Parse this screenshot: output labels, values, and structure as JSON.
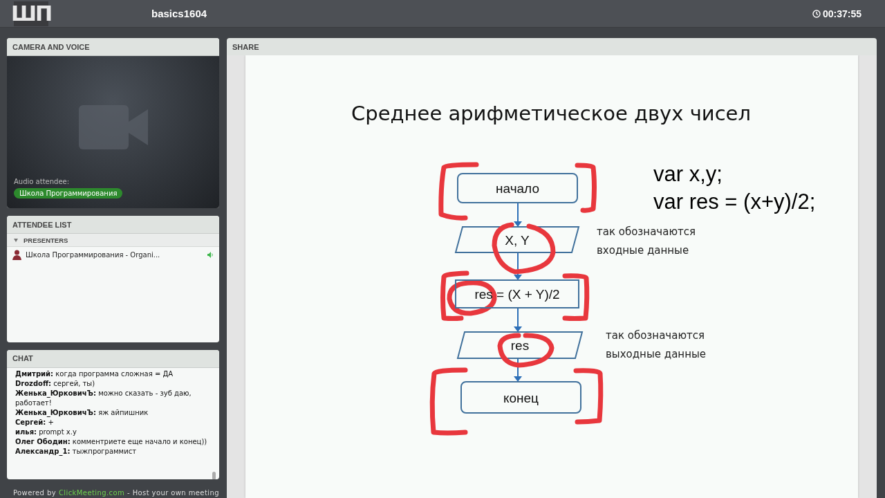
{
  "header": {
    "logo": "ШП",
    "title": "basics1604",
    "timer": "00:37:55"
  },
  "camera": {
    "title": "CAMERA AND VOICE",
    "audio_label": "Audio attendee:",
    "audio_name": "Школа Программирования"
  },
  "attendees": {
    "title": "ATTENDEE LIST",
    "groups": [
      {
        "name": "PRESENTERS",
        "expanded": true,
        "members": [
          {
            "name": "Школа Программирования - Organi...",
            "speaking": true
          }
        ]
      }
    ]
  },
  "chat": {
    "title": "CHAT",
    "messages": [
      {
        "author": "Дмитрий:",
        "text": "когда программа сложная = ДА"
      },
      {
        "author": "Drozdoff:",
        "text": "сергей, ты)"
      },
      {
        "author": "Женька_ЮрковичЪ:",
        "text": "можно сказать - зуб даю, работает!"
      },
      {
        "author": "Женька_ЮрковичЪ:",
        "text": "яж айпишник"
      },
      {
        "author": "Сергей:",
        "text": "+"
      },
      {
        "author": "илья:",
        "text": "prompt x.y"
      },
      {
        "author": "Олег Ободин:",
        "text": "комментриете еще начало и конец))"
      },
      {
        "author": "Александр_1:",
        "text": "тыжпрограммист"
      }
    ]
  },
  "footer": {
    "prefix": "Powered by",
    "link": "ClickMeeting.com",
    "suffix": "- Host your own meeting"
  },
  "share": {
    "title": "SHARE",
    "slide": {
      "title": "Среднее арифметическое двух чисел",
      "nodes": [
        {
          "kind": "terminal",
          "label": "начало"
        },
        {
          "kind": "io",
          "label": "X, Y"
        },
        {
          "kind": "process",
          "label": "res = (X + Y)/2"
        },
        {
          "kind": "io",
          "label": "res"
        },
        {
          "kind": "terminal",
          "label": "конец"
        }
      ],
      "code": [
        "var x,y;",
        "var res = (x+y)/2;"
      ],
      "notes": [
        {
          "lines": [
            "так обозначаются",
            "входные данные"
          ]
        },
        {
          "lines": [
            "так обозначаются",
            "выходные данные"
          ]
        }
      ]
    }
  }
}
